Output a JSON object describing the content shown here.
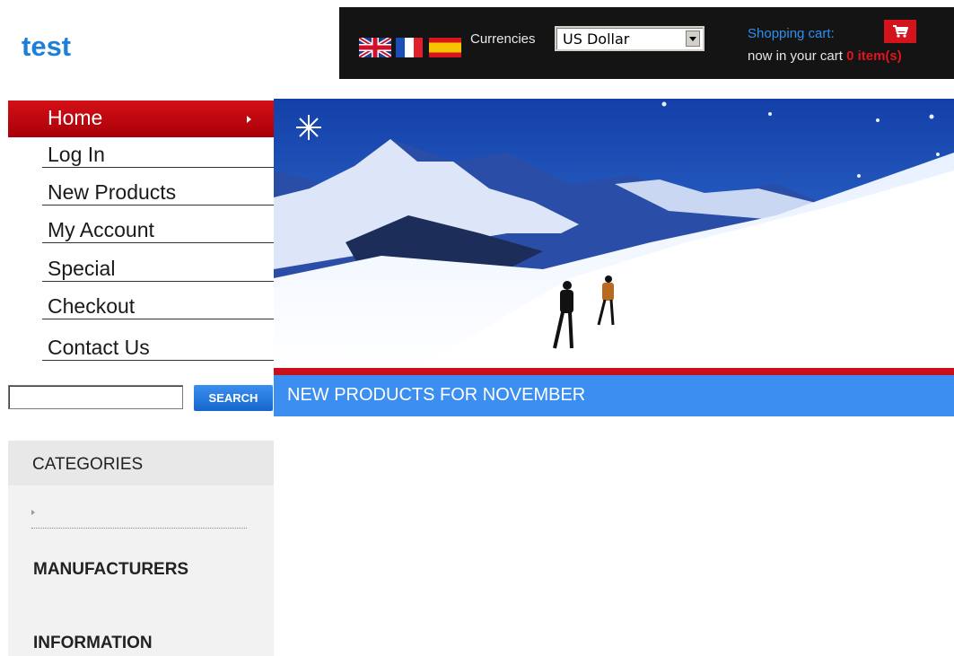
{
  "store": {
    "name": "test"
  },
  "header": {
    "languages": [
      "English",
      "Français",
      "Español"
    ],
    "currencies_label": "Currencies",
    "currency_selected": "US Dollar",
    "cart_title": "Shopping cart:",
    "cart_prefix": "now in your cart",
    "cart_count": "0 item(s)"
  },
  "nav": {
    "home": "Home",
    "items": [
      "Log In",
      "New Products",
      "My Account",
      "Special",
      "Checkout",
      "Contact Us"
    ]
  },
  "search": {
    "button_label": "SEARCH",
    "value": ""
  },
  "sidebar": {
    "categories_title": "CATEGORIES",
    "manufacturers_title": "MANUFACTURERS",
    "information_title": "INFORMATION"
  },
  "main": {
    "new_products_title": "NEW PRODUCTS FOR NOVEMBER"
  },
  "colors": {
    "accent_blue": "#3c8ff0",
    "accent_red": "#c9101a",
    "topbar": "#141414"
  },
  "icons": [
    "uk-flag-icon",
    "france-flag-icon",
    "spain-flag-icon",
    "cart-icon",
    "chevron-right-icon"
  ]
}
